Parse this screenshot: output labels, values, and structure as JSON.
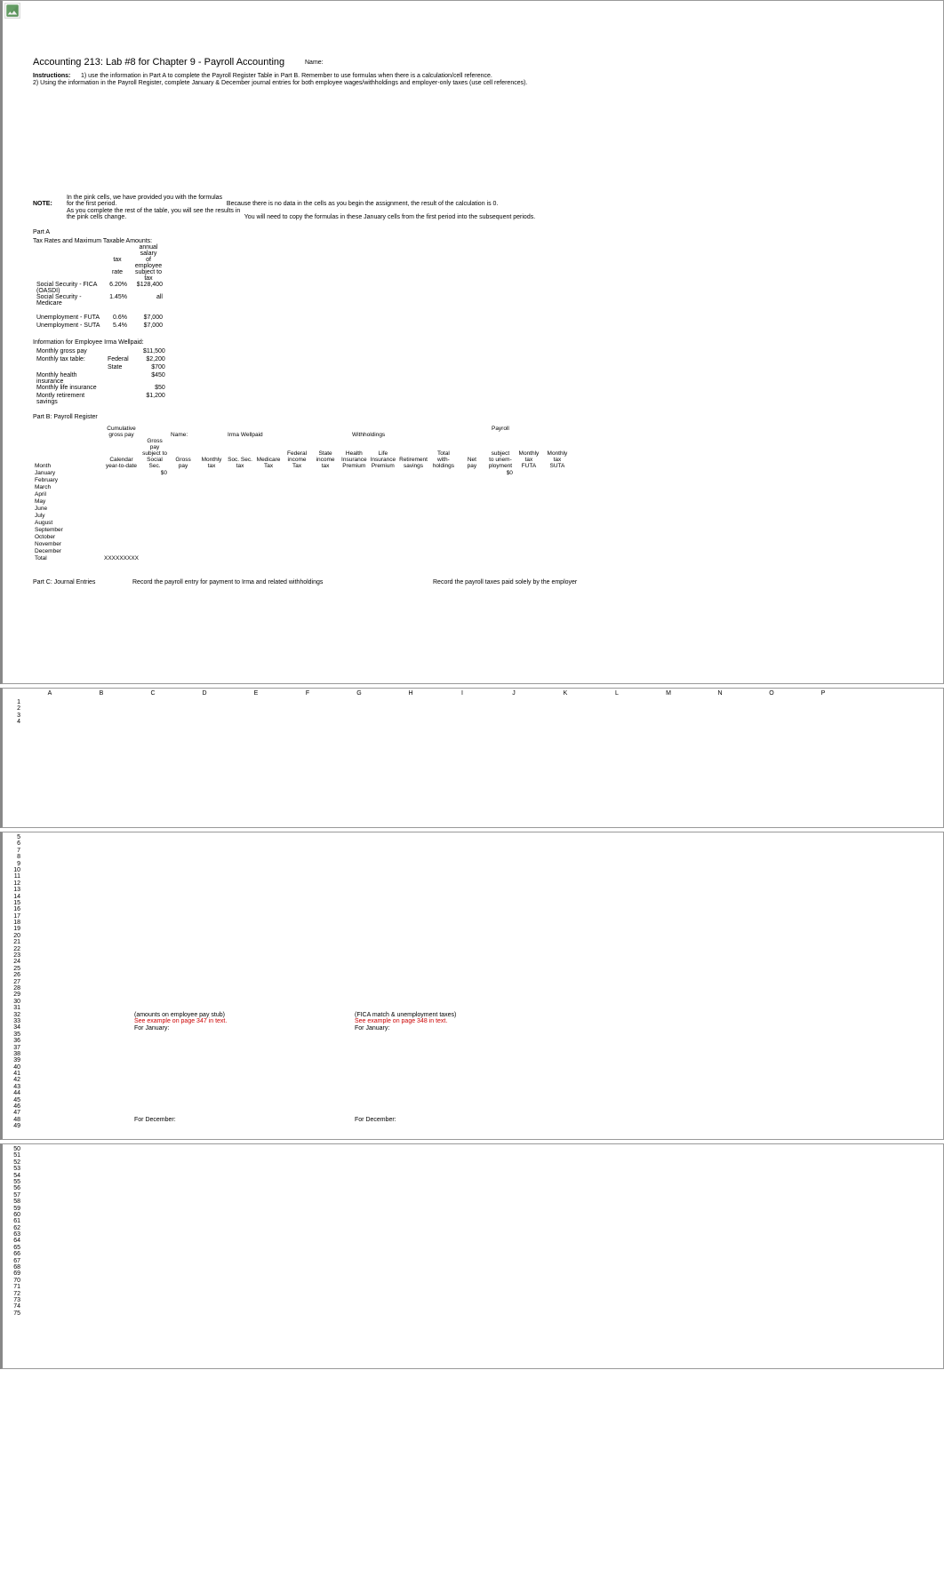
{
  "header": {
    "title": "Accounting 213: Lab #8 for Chapter 9 - Payroll Accounting",
    "name_label": "Name:",
    "instructions_label": "Instructions:",
    "instruction_1": "1) use the information in Part A to complete the Payroll Register Table in Part B. Remember to use formulas when there is a calculation/cell reference.",
    "instruction_2": "2) Using the information in the Payroll Register, complete January & December journal entries for both employee wages/withholdings and employer-only taxes (use cell references)."
  },
  "note": {
    "label": "NOTE:",
    "line1_left": "In the pink cells, we have provided you with the formulas for the first period.",
    "line1_right": "Because there is no data in the cells as you begin the assignment, the result of the calculation is 0.",
    "line2_left": "As you complete the rest of the table, you will see the results in the pink cells change.",
    "line2_right": "You will need to copy the formulas in these January cells from the first period into the subsequent periods."
  },
  "partA": {
    "title": "Part A",
    "subtitle": "Tax Rates and Maximum Taxable Amounts:",
    "col_headers": {
      "rate": "tax\nrate",
      "salary": "annual salary\nof employee\nsubject to tax"
    },
    "rows": [
      {
        "label": "Social Security - FICA (OASDI)",
        "rate": "6.20%",
        "amount": "$128,400"
      },
      {
        "label": "Social Security - Medicare",
        "rate": "1.45%",
        "amount": "all"
      },
      {
        "label": "",
        "rate": "",
        "amount": ""
      },
      {
        "label": "Unemployment - FUTA",
        "rate": "0.6%",
        "amount": "$7,000"
      },
      {
        "label": "Unemployment - SUTA",
        "rate": "5.4%",
        "amount": "$7,000"
      }
    ],
    "info_title": "Information for Employee Irma Wellpaid:",
    "info_rows": [
      {
        "label": "Monthly gross pay",
        "sub": "",
        "amount": "$11,500"
      },
      {
        "label": "Monthly tax table:",
        "sub": "Federal",
        "amount": "$2,200"
      },
      {
        "label": "",
        "sub": "State",
        "amount": "$700"
      },
      {
        "label": "Monthly health insurance",
        "sub": "",
        "amount": "$450"
      },
      {
        "label": "Monthly life insurance",
        "sub": "",
        "amount": "$50"
      },
      {
        "label": "Montly retirement savings",
        "sub": "",
        "amount": "$1,200"
      }
    ]
  },
  "partB": {
    "title": "Part B: Payroll Register",
    "name_label": "Name:",
    "name_value": "Irma Wellpaid",
    "withholdings_label": "Withholdings",
    "headers": [
      "Month",
      "Cumulative\ngross pay\nCalendar\nyear-to-date",
      "Gross pay\nsubject to\nSocial Sec.",
      "Gross pay",
      "Monthly\ntax",
      "Soc. Sec.\ntax",
      "Medicare\nTax",
      "Federal\nincome\nTax",
      "State\nincome\ntax",
      "Health\nInsurance\nPremium",
      "Life\nInsurance\nPremium",
      "Retirement\nsavings",
      "Total with-\nholdings",
      "Net\npay",
      "Payroll\nsubject\nto unem-\nployment",
      "Monthly\ntax\nFUTA",
      "Monthly\ntax\nSUTA"
    ],
    "months": [
      "January",
      "February",
      "March",
      "April",
      "May",
      "June",
      "July",
      "August",
      "September",
      "October",
      "November",
      "December"
    ],
    "total_label": "Total",
    "total_mark": "XXXXXXXXX",
    "jan_zeros": {
      "col3": "$0",
      "col15": "$0"
    }
  },
  "partC": {
    "title": "Part C: Journal Entries",
    "left_instruction": "Record the payroll entry for payment to Irma and related withholdings",
    "right_instruction": "Record the payroll taxes paid solely by the employer"
  },
  "grid": {
    "columns": [
      "A",
      "B",
      "C",
      "D",
      "E",
      "F",
      "G",
      "H",
      "I",
      "J",
      "K",
      "L",
      "M",
      "N",
      "O",
      "P"
    ],
    "page2_rows_a": [
      1,
      2,
      3,
      4
    ],
    "page2_rows_b": [
      5,
      6,
      7,
      8,
      9,
      10,
      11,
      12,
      13,
      14,
      15,
      16,
      17,
      18,
      19,
      20,
      21,
      22,
      23,
      24,
      25,
      26,
      27,
      28,
      29,
      30,
      31,
      32,
      33,
      34,
      35,
      36,
      37,
      38,
      39,
      40,
      41,
      42,
      43,
      44,
      45,
      46,
      47,
      48,
      49
    ],
    "page3_rows": [
      50,
      51,
      52,
      53,
      54,
      55,
      56,
      57,
      58,
      59,
      60,
      61,
      62,
      63,
      64,
      65,
      66,
      67,
      68,
      69,
      70,
      71,
      72,
      73,
      74,
      75
    ],
    "annotations": {
      "r32_left": "(amounts on employee pay stub)",
      "r32_right": "(FICA match & unemployment taxes)",
      "r33_left": "See example on page 347 in text.",
      "r33_right": "See example on page 348 in text.",
      "r34_left": "For January:",
      "r34_right": "For January:",
      "r48_left": "For December:",
      "r48_right": "For December:"
    }
  }
}
